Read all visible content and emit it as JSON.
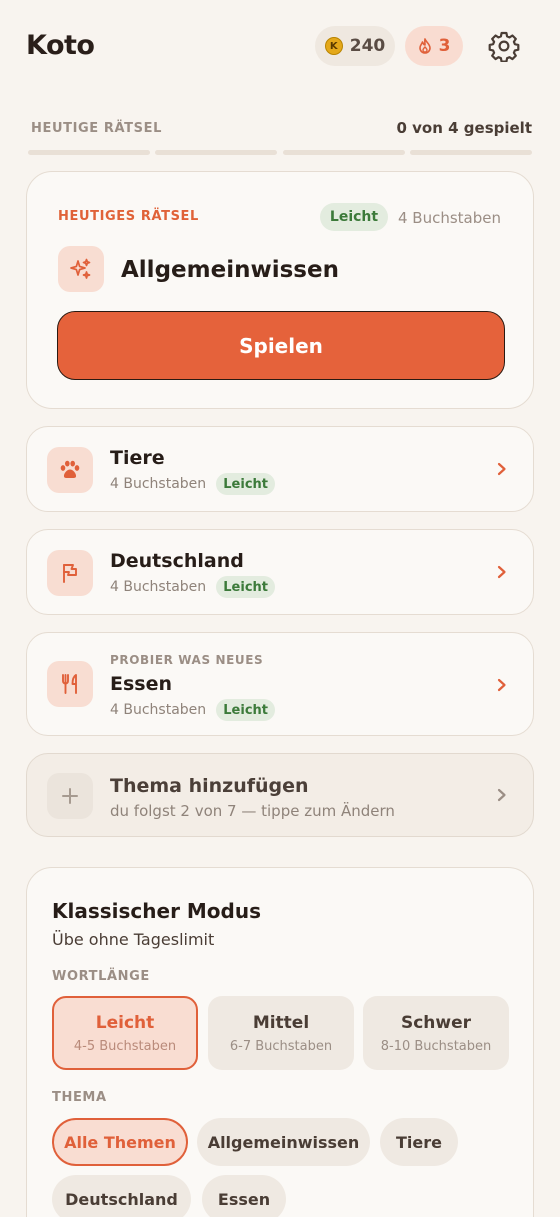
{
  "app": {
    "title": "Koto"
  },
  "header": {
    "coins": "240",
    "coin_symbol": "K",
    "streak": "3"
  },
  "progress": {
    "label": "HEUTIGE RÄTSEL",
    "count": "0 von 4 gespielt",
    "segments": 4,
    "played": 0
  },
  "daily": {
    "kicker": "HEUTIGES RÄTSEL",
    "difficulty": "Leicht",
    "letters": "4 Buchstaben",
    "title": "Allgemeinwissen",
    "play_label": "Spielen",
    "icon": "sparkles-icon"
  },
  "topics": [
    {
      "name": "Tiere",
      "letters": "4 Buchstaben",
      "difficulty": "Leicht",
      "icon": "paw-icon"
    },
    {
      "name": "Deutschland",
      "letters": "4 Buchstaben",
      "difficulty": "Leicht",
      "icon": "flag-icon"
    },
    {
      "kicker": "PROBIER WAS NEUES",
      "name": "Essen",
      "letters": "4 Buchstaben",
      "difficulty": "Leicht",
      "icon": "cutlery-icon"
    }
  ],
  "add_topic": {
    "title": "Thema hinzufügen",
    "subtitle": "du folgst 2 von 7 — tippe zum Ändern",
    "icon": "plus-icon"
  },
  "classic": {
    "title": "Klassischer Modus",
    "subtitle": "Übe ohne Tageslimit",
    "length_label": "WORTLÄNGE",
    "lengths": [
      {
        "name": "Leicht",
        "range": "4-5 Buchstaben",
        "selected": true
      },
      {
        "name": "Mittel",
        "range": "6-7 Buchstaben",
        "selected": false
      },
      {
        "name": "Schwer",
        "range": "8-10 Buchstaben",
        "selected": false
      }
    ],
    "theme_label": "THEMA",
    "themes": [
      {
        "name": "Alle Themen",
        "selected": true
      },
      {
        "name": "Allgemeinwissen",
        "selected": false
      },
      {
        "name": "Tiere",
        "selected": false
      },
      {
        "name": "Deutschland",
        "selected": false
      },
      {
        "name": "Essen",
        "selected": false
      }
    ]
  },
  "colors": {
    "accent": "#e5623b",
    "background": "#f8f4ef",
    "success_bg": "#e3ecdf",
    "success_text": "#3c7a3a"
  }
}
